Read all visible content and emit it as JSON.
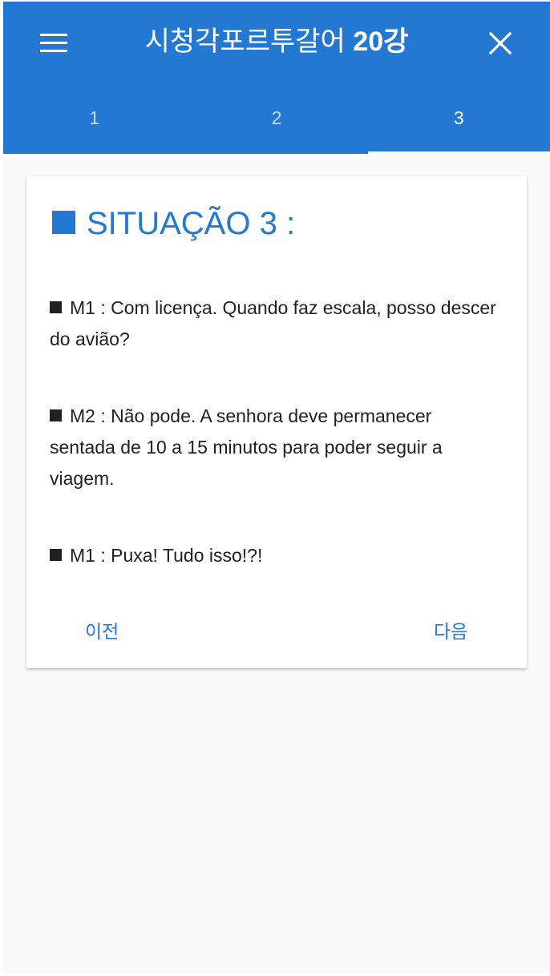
{
  "app_bar": {
    "title_text": "시청각포르투갈어",
    "title_number": "20강",
    "menu_icon": "menu-icon",
    "close_icon": "close-icon"
  },
  "tabs": [
    {
      "label": "1",
      "active": false
    },
    {
      "label": "2",
      "active": false
    },
    {
      "label": "3",
      "active": true
    }
  ],
  "content": {
    "heading": "SITUAÇÃO 3 :",
    "lines": [
      {
        "text": "M1 : Com licença. Quando faz escala, posso descer do avião?"
      },
      {
        "text": "M2 : Não pode. A senhora deve permanecer sentada de 10 a 15 minutos para poder seguir a viagem."
      },
      {
        "text": "M1 : Puxa! Tudo isso!?!"
      }
    ]
  },
  "nav": {
    "prev_label": "이전",
    "next_label": "다음"
  },
  "colors": {
    "primary": "#2378d1",
    "background": "#f9f9f9",
    "text": "#212121",
    "card": "#ffffff"
  }
}
